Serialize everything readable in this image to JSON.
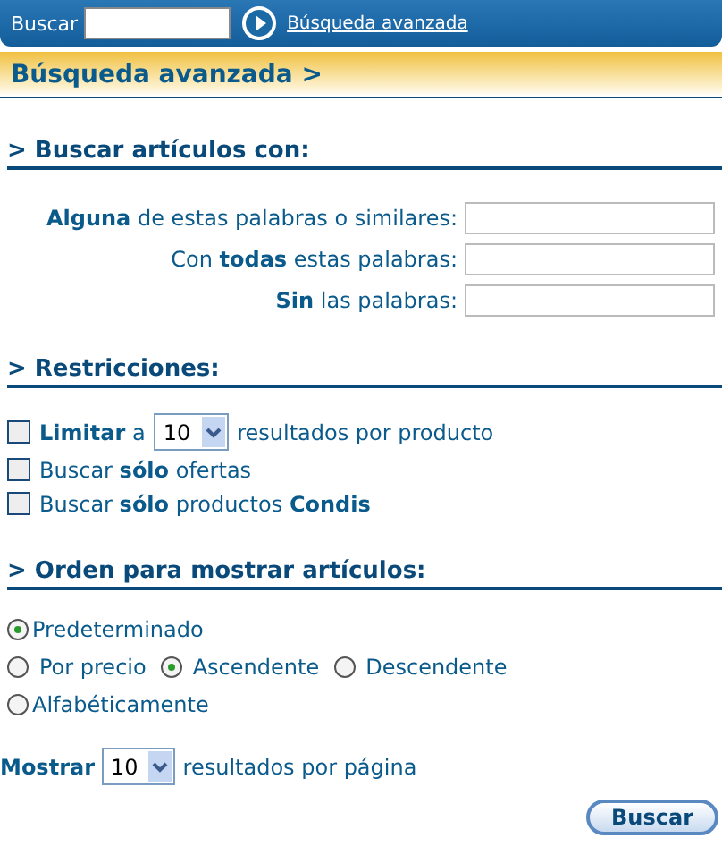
{
  "top_bar": {
    "label": "Buscar",
    "advanced_link": "Búsqueda avanzada"
  },
  "page_title": "Búsqueda avanzada >",
  "sections": [
    {
      "heading": "> Buscar artículos con:",
      "kind": "fields",
      "fields": [
        {
          "label": "**Alguna** de estas palabras o similares:"
        },
        {
          "label": "Con **todas** estas palabras:"
        },
        {
          "label": "**Sin** las palabras:"
        }
      ]
    },
    {
      "heading": "> Restricciones:",
      "kind": "checkboxes",
      "options": [
        {
          "kind": "select",
          "before": "**Limitar** a",
          "select_value": "10",
          "after": "resultados por producto",
          "checked": false
        },
        {
          "kind": "plain",
          "label": "Buscar **sólo** ofertas",
          "checked": false
        },
        {
          "kind": "plain",
          "label": "Buscar **sólo** productos **Condis**",
          "checked": false
        }
      ]
    },
    {
      "heading": "> Orden para mostrar artículos:",
      "kind": "radios",
      "rows": [
        [
          {
            "label": "Predeterminado",
            "selected": true
          }
        ],
        [
          {
            "label": "Por precio",
            "selected": false
          },
          {
            "label": "Ascendente",
            "selected": true
          },
          {
            "label": "Descendente",
            "selected": false
          }
        ],
        [
          {
            "label": "Alfabéticamente",
            "selected": false
          }
        ]
      ]
    }
  ],
  "per_page": {
    "label": "Mostrar",
    "select_value": "10",
    "after": "resultados por página"
  },
  "submit_button": "Buscar"
}
